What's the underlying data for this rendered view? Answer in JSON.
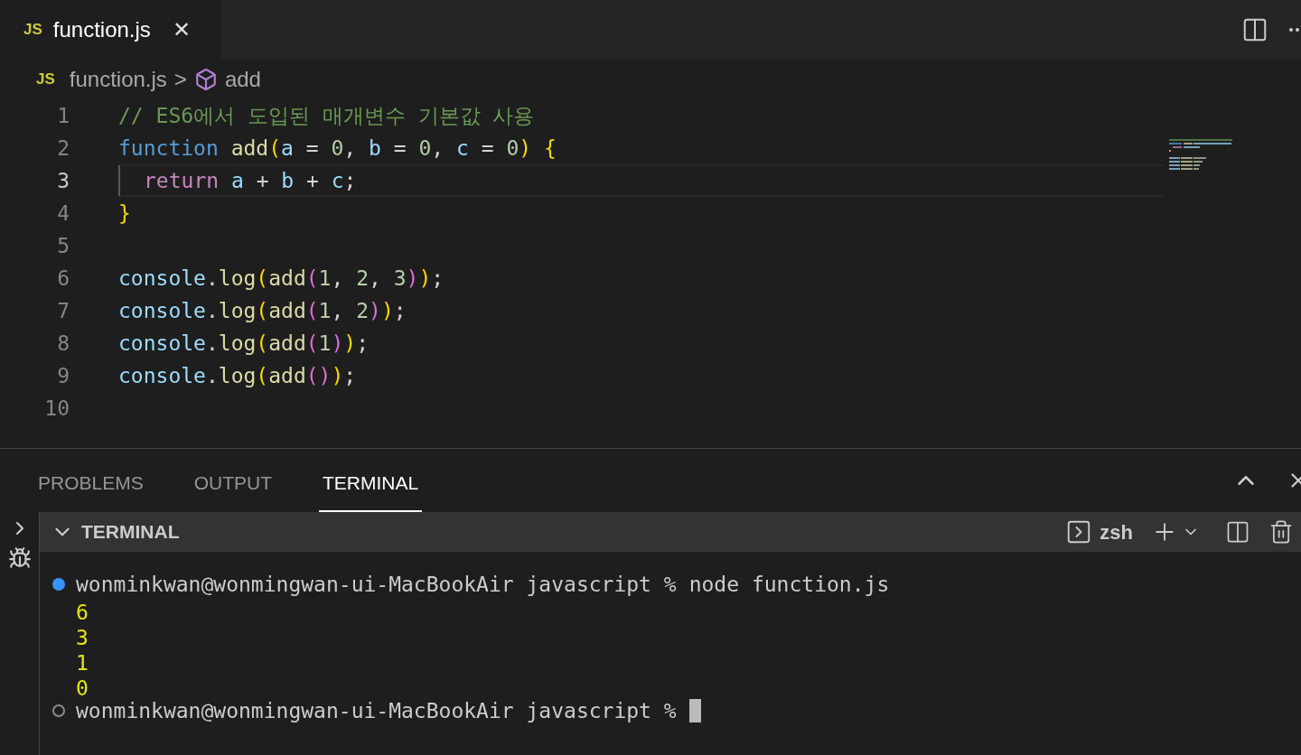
{
  "editor_tabs": [
    {
      "label": "JS",
      "title": "function.js",
      "close": "✕",
      "selected": true
    }
  ],
  "breadcrumb": {
    "file_icon": "JS",
    "file": "function.js",
    "separator": ">",
    "symbol": "add"
  },
  "code_lines": [
    {
      "number": "1",
      "current": false,
      "tokens": [
        {
          "kind": "comment",
          "text": "// ES6에서 도입된 매개변수 기본값 사용"
        }
      ]
    },
    {
      "number": "2",
      "current": false,
      "tokens": [
        {
          "kind": "keyword",
          "text": "function "
        },
        {
          "kind": "fn",
          "text": "add"
        },
        {
          "kind": "bracket1",
          "text": "("
        },
        {
          "kind": "var",
          "text": "a"
        },
        {
          "kind": "plain",
          "text": " = "
        },
        {
          "kind": "num",
          "text": "0"
        },
        {
          "kind": "plain",
          "text": ", "
        },
        {
          "kind": "var",
          "text": "b"
        },
        {
          "kind": "plain",
          "text": " = "
        },
        {
          "kind": "num",
          "text": "0"
        },
        {
          "kind": "plain",
          "text": ", "
        },
        {
          "kind": "var",
          "text": "c"
        },
        {
          "kind": "plain",
          "text": " = "
        },
        {
          "kind": "num",
          "text": "0"
        },
        {
          "kind": "bracket1",
          "text": ") {"
        }
      ]
    },
    {
      "number": "3",
      "current": true,
      "indent": true,
      "tokens": [
        {
          "kind": "control",
          "text": "return "
        },
        {
          "kind": "var",
          "text": "a"
        },
        {
          "kind": "plain",
          "text": " + "
        },
        {
          "kind": "var",
          "text": "b"
        },
        {
          "kind": "plain",
          "text": " + "
        },
        {
          "kind": "var",
          "text": "c"
        },
        {
          "kind": "plain",
          "text": ";"
        }
      ]
    },
    {
      "number": "4",
      "current": false,
      "tokens": [
        {
          "kind": "bracket1",
          "text": "}"
        }
      ]
    },
    {
      "number": "5",
      "current": false
    },
    {
      "number": "6",
      "current": false,
      "tokens": [
        {
          "kind": "var",
          "text": "console"
        },
        {
          "kind": "plain",
          "text": "."
        },
        {
          "kind": "fn",
          "text": "log"
        },
        {
          "kind": "bracket1",
          "text": "("
        },
        {
          "kind": "fn",
          "text": "add"
        },
        {
          "kind": "bracket2",
          "text": "("
        },
        {
          "kind": "num",
          "text": "1"
        },
        {
          "kind": "plain",
          "text": ", "
        },
        {
          "kind": "num",
          "text": "2"
        },
        {
          "kind": "plain",
          "text": ", "
        },
        {
          "kind": "num",
          "text": "3"
        },
        {
          "kind": "bracket2",
          "text": ")"
        },
        {
          "kind": "bracket1",
          "text": ")"
        },
        {
          "kind": "plain",
          "text": ";"
        }
      ]
    },
    {
      "number": "7",
      "current": false,
      "tokens": [
        {
          "kind": "var",
          "text": "console"
        },
        {
          "kind": "plain",
          "text": "."
        },
        {
          "kind": "fn",
          "text": "log"
        },
        {
          "kind": "bracket1",
          "text": "("
        },
        {
          "kind": "fn",
          "text": "add"
        },
        {
          "kind": "bracket2",
          "text": "("
        },
        {
          "kind": "num",
          "text": "1"
        },
        {
          "kind": "plain",
          "text": ", "
        },
        {
          "kind": "num",
          "text": "2"
        },
        {
          "kind": "bracket2",
          "text": ")"
        },
        {
          "kind": "bracket1",
          "text": ")"
        },
        {
          "kind": "plain",
          "text": ";"
        }
      ]
    },
    {
      "number": "8",
      "current": false,
      "tokens": [
        {
          "kind": "var",
          "text": "console"
        },
        {
          "kind": "plain",
          "text": "."
        },
        {
          "kind": "fn",
          "text": "log"
        },
        {
          "kind": "bracket1",
          "text": "("
        },
        {
          "kind": "fn",
          "text": "add"
        },
        {
          "kind": "bracket2",
          "text": "("
        },
        {
          "kind": "num",
          "text": "1"
        },
        {
          "kind": "bracket2",
          "text": ")"
        },
        {
          "kind": "bracket1",
          "text": ")"
        },
        {
          "kind": "plain",
          "text": ";"
        }
      ]
    },
    {
      "number": "9",
      "current": false,
      "tokens": [
        {
          "kind": "var",
          "text": "console"
        },
        {
          "kind": "plain",
          "text": "."
        },
        {
          "kind": "fn",
          "text": "log"
        },
        {
          "kind": "bracket1",
          "text": "("
        },
        {
          "kind": "fn",
          "text": "add"
        },
        {
          "kind": "bracket2",
          "text": "("
        },
        {
          "kind": "bracket2",
          "text": ")"
        },
        {
          "kind": "bracket1",
          "text": ")"
        },
        {
          "kind": "plain",
          "text": ";"
        }
      ]
    },
    {
      "number": "10",
      "current": false
    }
  ],
  "panel_tabs": [
    {
      "label": "PROBLEMS",
      "selected": false
    },
    {
      "label": "OUTPUT",
      "selected": false
    },
    {
      "label": "TERMINAL",
      "selected": true
    }
  ],
  "terminal_header": {
    "title": "TERMINAL",
    "shell": "zsh"
  },
  "terminal_lines": [
    {
      "kind": "command",
      "done": true,
      "prompt": "wonminkwan@wonmingwan-ui-MacBookAir javascript %",
      "command": "node function.js"
    },
    {
      "kind": "output",
      "text": "6"
    },
    {
      "kind": "output",
      "text": "3"
    },
    {
      "kind": "output",
      "text": "1"
    },
    {
      "kind": "output",
      "text": "0"
    },
    {
      "kind": "command",
      "done": false,
      "prompt": "wonminkwan@wonmingwan-ui-MacBookAir javascript %"
    }
  ]
}
